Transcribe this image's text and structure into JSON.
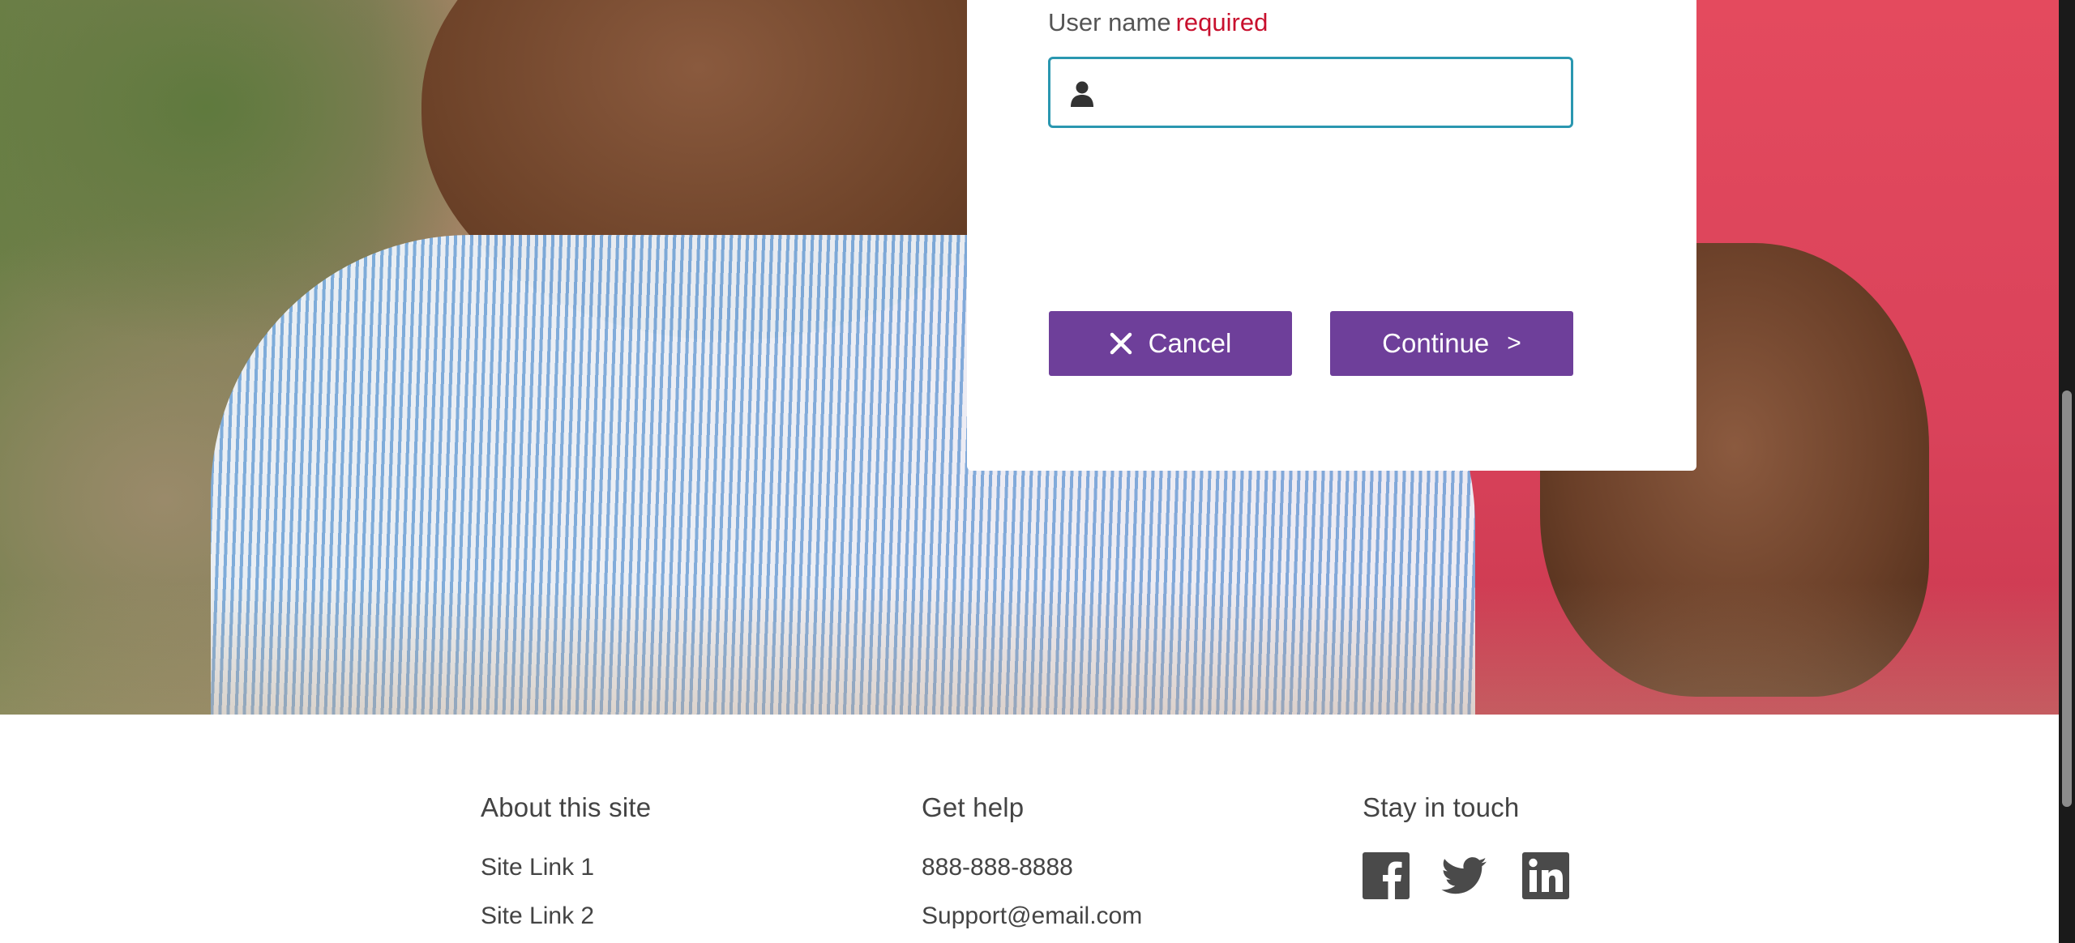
{
  "form": {
    "username_label": "User name",
    "required_label": "required",
    "username_value": "",
    "username_placeholder": ""
  },
  "buttons": {
    "cancel_label": "Cancel",
    "continue_label": "Continue",
    "continue_chevron": ">"
  },
  "footer": {
    "about": {
      "heading": "About this site",
      "links": [
        "Site Link 1",
        "Site Link 2"
      ]
    },
    "help": {
      "heading": "Get help",
      "phone": "888-888-8888",
      "email": "Support@email.com"
    },
    "touch": {
      "heading": "Stay in touch",
      "social": [
        "facebook-icon",
        "twitter-icon",
        "linkedin-icon"
      ]
    }
  },
  "icons": {
    "input_icon": "user-icon",
    "cancel_icon": "close-icon"
  },
  "colors": {
    "primary_button": "#6e3f9a",
    "input_focus_border": "#2a97b0",
    "required_text": "#c8102e",
    "social_icon": "#4a4a4a"
  }
}
